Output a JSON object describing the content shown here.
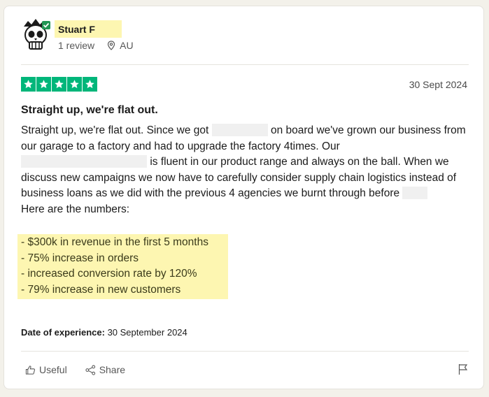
{
  "reviewer": {
    "name": "Stuart F",
    "review_count": "1 review",
    "country": "AU"
  },
  "review": {
    "rating": 5,
    "date": "30 Sept 2024",
    "title": "Straight up, we're flat out.",
    "paragraph_parts": {
      "p1": "Straight up, we're flat out. Since we got",
      "p2": "on board we've grown our business from our garage to a factory and had to upgrade the factory 4times. Our",
      "p3": "is fluent in our product range and always on the ball. When we discuss new campaigns we now have to carefully consider supply chain logistics instead of business loans as we did with the previous 4 agencies we burnt through before"
    },
    "numbers_intro": "Here are the numbers:",
    "highlights": [
      "- $300k in revenue in the first 5 months",
      "- 75% increase in orders",
      "- increased conversion rate by 120%",
      "- 79% increase in new customers"
    ],
    "experience_label": "Date of experience:",
    "experience_date": "30 September 2024"
  },
  "actions": {
    "useful": "Useful",
    "share": "Share"
  },
  "colors": {
    "star_green": "#00b67a",
    "highlight_yellow": "#fdf6b1",
    "verified_green": "#219653"
  },
  "icons": [
    "skull-avatar-icon",
    "verified-check-icon",
    "location-pin-icon",
    "star-icon",
    "thumbs-up-icon",
    "share-icon",
    "flag-icon"
  ]
}
